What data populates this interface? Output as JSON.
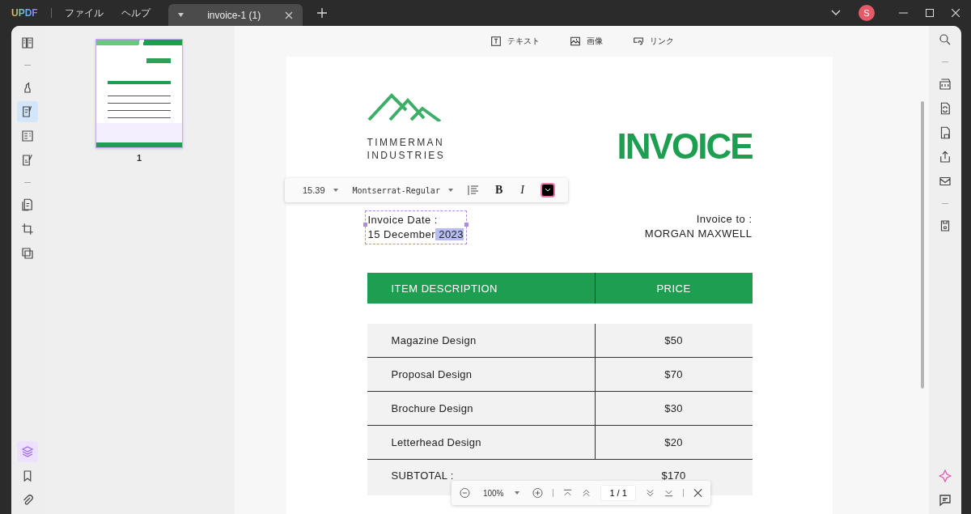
{
  "app": {
    "logo": "UPDF",
    "menus": [
      "ファイル",
      "ヘルプ"
    ],
    "avatar": "S"
  },
  "tabs": [
    {
      "label": "invoice-1 (1)",
      "selected": true
    }
  ],
  "left_tools": [
    [
      {
        "kind": "reader",
        "selected": false
      }
    ],
    [
      {
        "kind": "highlight",
        "selected": false
      },
      {
        "kind": "edit",
        "selected": true
      },
      {
        "kind": "form",
        "selected": false
      },
      {
        "kind": "sign",
        "selected": false
      }
    ],
    [
      {
        "kind": "pages",
        "selected": false
      },
      {
        "kind": "crop",
        "selected": false
      },
      {
        "kind": "overlay",
        "selected": false
      }
    ]
  ],
  "left_bottom_tools": [
    {
      "kind": "layers",
      "selected": true
    },
    {
      "kind": "bookmark",
      "selected": false
    },
    {
      "kind": "attachment",
      "selected": false
    }
  ],
  "thumbnails": [
    {
      "page_label": "1",
      "selected": true
    }
  ],
  "edit_tools": [
    {
      "kind": "text",
      "label": "テキスト"
    },
    {
      "kind": "image",
      "label": "画像"
    },
    {
      "kind": "link",
      "label": "リンク"
    }
  ],
  "right_tools": [
    [
      {
        "kind": "search"
      }
    ],
    [
      {
        "kind": "ocr"
      },
      {
        "kind": "convert"
      },
      {
        "kind": "protect"
      },
      {
        "kind": "share"
      },
      {
        "kind": "mail"
      }
    ],
    [
      {
        "kind": "save"
      }
    ]
  ],
  "right_bottom_tools": [
    {
      "kind": "ai"
    },
    {
      "kind": "comment"
    }
  ],
  "format_toolbar": {
    "font_size": "15.39",
    "font": "Montserrat-Regular",
    "bold": "B",
    "italic": "I"
  },
  "invoice": {
    "company": [
      "TIMMERMAN",
      "INDUSTRIES"
    ],
    "title": "INVOICE",
    "date_label": "Invoice Date :",
    "date_value": "15 December",
    "date_selected": " 2023",
    "to_label": "Invoice to :",
    "client": "MORGAN MAXWELL",
    "columns": [
      "ITEM DESCRIPTION",
      "PRICE"
    ],
    "rows": [
      {
        "item": "Magazine Design",
        "price": "$50"
      },
      {
        "item": "Proposal Design",
        "price": "$70"
      },
      {
        "item": "Brochure Design",
        "price": "$30"
      },
      {
        "item": "Letterhead Design",
        "price": "$20"
      }
    ],
    "subtotal": {
      "label": "SUBTOTAL :",
      "value": "$170"
    }
  },
  "zoom_bar": {
    "zoom": "100%",
    "page": "1 / 1"
  }
}
